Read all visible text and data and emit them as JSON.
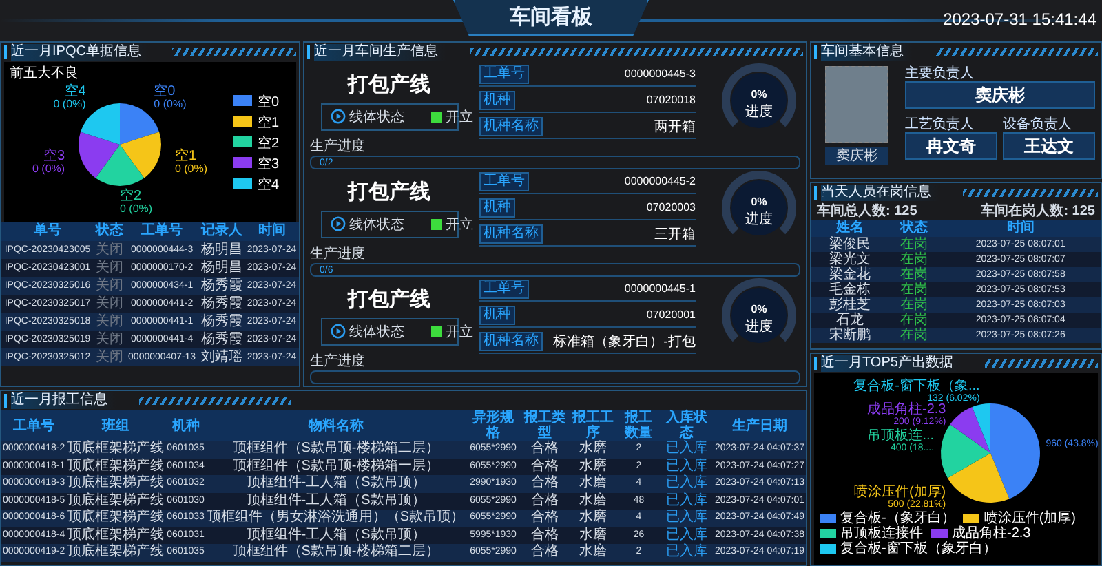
{
  "header": {
    "title": "车间看板",
    "datetime": "2023-07-31 15:41:44"
  },
  "ipqc": {
    "title": "近一月IPQC单据信息",
    "defect_chart": {
      "title": "前五大不良",
      "slices": [
        {
          "name": "空0",
          "label": "0 (0%)"
        },
        {
          "name": "空1",
          "label": "0 (0%)"
        },
        {
          "name": "空2",
          "label": "0 (0%)"
        },
        {
          "name": "空3",
          "label": "0 (0%)"
        },
        {
          "name": "空4",
          "label": "0 (0%)"
        }
      ],
      "legend": [
        "空0",
        "空1",
        "空2",
        "空3",
        "空4"
      ]
    },
    "columns": [
      "单号",
      "状态",
      "工单号",
      "记录人",
      "时间"
    ],
    "rows": [
      [
        "IPQC-20230423005",
        "关闭",
        "0000000444-3",
        "杨明昌",
        "2023-07-24"
      ],
      [
        "IPQC-20230423001",
        "关闭",
        "0000000170-2",
        "杨明昌",
        "2023-07-24"
      ],
      [
        "IPQC-20230325016",
        "关闭",
        "0000000434-1",
        "杨秀霞",
        "2023-07-24"
      ],
      [
        "IPQC-20230325017",
        "关闭",
        "0000000441-2",
        "杨秀霞",
        "2023-07-24"
      ],
      [
        "IPQC-20230325018",
        "关闭",
        "0000000441-1",
        "杨秀霞",
        "2023-07-24"
      ],
      [
        "IPQC-20230325019",
        "关闭",
        "0000000441-4",
        "杨秀霞",
        "2023-07-24"
      ],
      [
        "IPQC-20230325012",
        "关闭",
        "0000000407-13",
        "刘靖瑶",
        "2023-07-24"
      ]
    ]
  },
  "production": {
    "title": "近一月车间生产信息",
    "lines": [
      {
        "name": "打包产线",
        "status_label": "线体状态",
        "status": "开立",
        "on": true,
        "fields": [
          {
            "label": "工单号",
            "value": "0000000445-3"
          },
          {
            "label": "机种",
            "value": "07020018"
          },
          {
            "label": "机种名称",
            "value": "两开箱"
          }
        ],
        "gauge": {
          "reading": "0%",
          "label": "进度",
          "level": 0
        },
        "progress": {
          "label": "生产进度",
          "text": "0/2",
          "level": 0
        }
      },
      {
        "name": "打包产线",
        "status_label": "线体状态",
        "status": "开立",
        "on": true,
        "fields": [
          {
            "label": "工单号",
            "value": "0000000445-2"
          },
          {
            "label": "机种",
            "value": "07020003"
          },
          {
            "label": "机种名称",
            "value": "三开箱"
          }
        ],
        "gauge": {
          "reading": "0%",
          "label": "进度",
          "level": 0
        },
        "progress": {
          "label": "生产进度",
          "text": "0/6",
          "level": 0
        }
      },
      {
        "name": "打包产线",
        "status_label": "线体状态",
        "status": "开立",
        "on": true,
        "fields": [
          {
            "label": "工单号",
            "value": "0000000445-1"
          },
          {
            "label": "机种",
            "value": "07020001"
          },
          {
            "label": "机种名称",
            "value": "标准箱（象牙白）-打包"
          }
        ],
        "gauge": {
          "reading": "0%",
          "label": "进度",
          "level": 0
        },
        "progress": {
          "label": "生产进度",
          "level": 0
        }
      }
    ]
  },
  "info": {
    "title": "车间基本信息",
    "photo_caption": "窦庆彬",
    "roles": [
      {
        "label": "主要负责人",
        "name": "窦庆彬"
      },
      {
        "label": "工艺负责人",
        "name": "冉文奇"
      },
      {
        "label": "设备负责人",
        "name": "王达文"
      }
    ]
  },
  "staff": {
    "title": "当天人员在岗信息",
    "totals": [
      "车间总人数: 125",
      "车间在岗人数: 125"
    ],
    "columns": [
      "姓名",
      "状态",
      "时间"
    ],
    "rows": [
      [
        "梁俊民",
        "在岗",
        "2023-07-25 08:07:01"
      ],
      [
        "梁光文",
        "在岗",
        "2023-07-25 08:07:07"
      ],
      [
        "梁金花",
        "在岗",
        "2023-07-25 08:07:58"
      ],
      [
        "毛金栋",
        "在岗",
        "2023-07-25 08:07:53"
      ],
      [
        "彭桂芝",
        "在岗",
        "2023-07-25 08:07:03"
      ],
      [
        "石龙",
        "在岗",
        "2023-07-25 08:07:04"
      ],
      [
        "宋断鹏",
        "在岗",
        "2023-07-25 08:07:26"
      ]
    ]
  },
  "reports": {
    "title": "近一月报工信息",
    "columns": [
      "工单号",
      "班组",
      "机种",
      "物料名称",
      "异形规格",
      "报工类型",
      "报工工序",
      "报工数量",
      "入库状态",
      "生产日期"
    ],
    "rows": [
      [
        "0000000418-2",
        "顶底框架梯产线",
        "0601035",
        "顶框组件（S款吊顶-楼梯箱二层）",
        "6055*2990",
        "合格",
        "水磨",
        "2",
        "已入库",
        "2023-07-24 04:07:37"
      ],
      [
        "0000000418-1",
        "顶底框架梯产线",
        "0601034",
        "顶框组件（S款吊顶-楼梯箱一层）",
        "6055*2990",
        "合格",
        "水磨",
        "2",
        "已入库",
        "2023-07-24 04:07:27"
      ],
      [
        "0000000418-3",
        "顶底框架梯产线",
        "0601032",
        "顶框组件-工人箱（S款吊顶）",
        "2990*1930",
        "合格",
        "水磨",
        "4",
        "已入库",
        "2023-07-24 04:07:13"
      ],
      [
        "0000000418-5",
        "顶底框架梯产线",
        "0601030",
        "顶框组件-工人箱（S款吊顶）",
        "6055*2990",
        "合格",
        "水磨",
        "48",
        "已入库",
        "2023-07-24 04:07:01"
      ],
      [
        "0000000418-6",
        "顶底框架梯产线",
        "0601033",
        "顶框组件（男女淋浴洗通用）（S款吊顶）",
        "6055*2990",
        "合格",
        "水磨",
        "4",
        "已入库",
        "2023-07-24 04:07:49"
      ],
      [
        "0000000418-4",
        "顶底框架梯产线",
        "0601031",
        "顶框组件-工人箱（S款吊顶）",
        "5995*1930",
        "合格",
        "水磨",
        "26",
        "已入库",
        "2023-07-24 04:07:38"
      ],
      [
        "0000000419-2",
        "顶底框架梯产线",
        "0601035",
        "顶框组件（S款吊顶-楼梯箱二层）",
        "6055*2990",
        "合格",
        "水磨",
        "2",
        "已入库",
        "2023-07-24 04:07:19"
      ]
    ]
  },
  "top5": {
    "title": "近一月TOP5产出数据",
    "chart_data": {
      "type": "pie",
      "categories": [
        "复合板-（象牙白）",
        "喷涂压件(加厚)",
        "吊顶板连接件",
        "成品角柱-2.3",
        "复合板-窗下板（象牙白）"
      ],
      "values": [
        960,
        500,
        400,
        200,
        132
      ],
      "legend": "bottom",
      "value_labels": [
        "960 (43.8%)",
        "500 (22.81%)",
        "400 (18....",
        "200 (9.12%)",
        "132 (6.02%)"
      ],
      "annotations": [
        null,
        "喷涂压件(加厚)",
        "吊顶板连...",
        "成品角柱-2.3",
        "复合板-窗下板（象..."
      ]
    }
  }
}
